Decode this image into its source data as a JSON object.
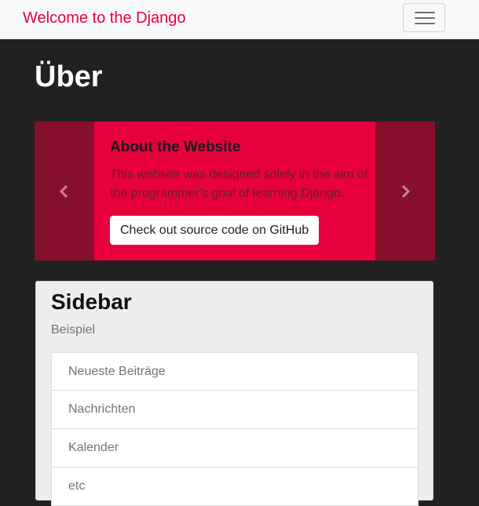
{
  "navbar": {
    "brand": "Welcome to the Django",
    "toggler_icon": "hamburger-menu-icon"
  },
  "page": {
    "title": "Über"
  },
  "carousel": {
    "title": "About the Website",
    "text": "This website was designed solely in the aim of the programmer's goal of learning Django.",
    "button_label": "Check out source code on GitHub",
    "prev_icon": "chevron-left-icon",
    "next_icon": "chevron-right-icon"
  },
  "sidebar": {
    "title": "Sidebar",
    "subtitle": "Beispiel",
    "items": [
      {
        "label": "Neueste Beiträge"
      },
      {
        "label": "Nachrichten"
      },
      {
        "label": "Kalender"
      },
      {
        "label": "etc"
      }
    ]
  },
  "colors": {
    "brand": "#e8003d",
    "background": "#212121",
    "carousel_control": "#86102c",
    "navbar": "#f8f9fa"
  }
}
